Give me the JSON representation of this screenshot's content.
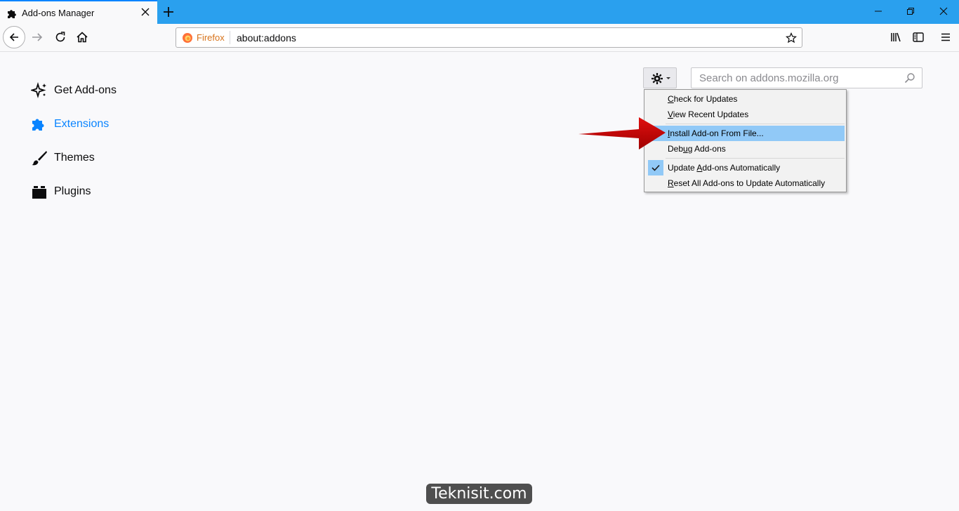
{
  "browser": {
    "tab_title": "Add-ons Manager",
    "identity_label": "Firefox",
    "url": "about:addons"
  },
  "sidebar": {
    "items": [
      {
        "label": "Get Add-ons",
        "icon": "sparkle-icon"
      },
      {
        "label": "Extensions",
        "icon": "puzzle-icon",
        "selected": true
      },
      {
        "label": "Themes",
        "icon": "brush-icon"
      },
      {
        "label": "Plugins",
        "icon": "plugin-icon"
      }
    ]
  },
  "search": {
    "placeholder": "Search on addons.mozilla.org"
  },
  "tools_menu": {
    "items": [
      {
        "pre": "",
        "key": "C",
        "post": "heck for Updates"
      },
      {
        "pre": "",
        "key": "V",
        "post": "iew Recent Updates"
      },
      {
        "pre": "",
        "key": "I",
        "post": "nstall Add-on From File...",
        "highlighted": true
      },
      {
        "pre": "Deb",
        "key": "u",
        "post": "g Add-ons"
      },
      {
        "pre": "Update ",
        "key": "A",
        "post": "dd-ons Automatically",
        "checked": true
      },
      {
        "pre": "",
        "key": "R",
        "post": "eset All Add-ons to Update Automatically"
      }
    ]
  },
  "colors": {
    "accent": "#0a84ff",
    "tabstrip": "#2aa0ee",
    "menu_highlight": "#91c9f7",
    "arrow": "#c00000"
  },
  "watermark": "Teknisit.com"
}
